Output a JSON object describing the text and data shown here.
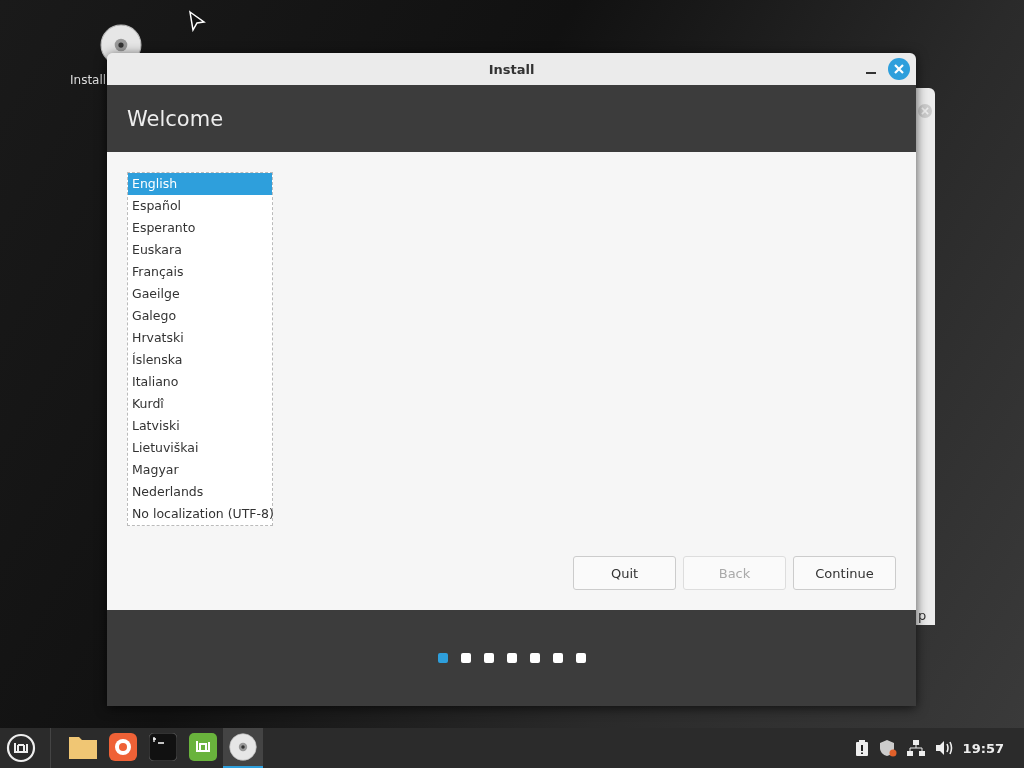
{
  "desktop_icons": [
    {
      "label": "Install"
    }
  ],
  "background_window": {
    "label": "p"
  },
  "window": {
    "title": "Install",
    "header": "Welcome",
    "languages": [
      {
        "label": "English",
        "selected": true
      },
      {
        "label": "Español",
        "selected": false
      },
      {
        "label": "Esperanto",
        "selected": false
      },
      {
        "label": "Euskara",
        "selected": false
      },
      {
        "label": "Français",
        "selected": false
      },
      {
        "label": "Gaeilge",
        "selected": false
      },
      {
        "label": "Galego",
        "selected": false
      },
      {
        "label": "Hrvatski",
        "selected": false
      },
      {
        "label": "Íslenska",
        "selected": false
      },
      {
        "label": "Italiano",
        "selected": false
      },
      {
        "label": "Kurdî",
        "selected": false
      },
      {
        "label": "Latviski",
        "selected": false
      },
      {
        "label": "Lietuviškai",
        "selected": false
      },
      {
        "label": "Magyar",
        "selected": false
      },
      {
        "label": "Nederlands",
        "selected": false
      },
      {
        "label": "No localization (UTF-8)",
        "selected": false
      }
    ],
    "buttons": [
      {
        "label": "Quit",
        "disabled": false
      },
      {
        "label": "Back",
        "disabled": true
      },
      {
        "label": "Continue",
        "disabled": false
      }
    ],
    "steps": [
      {
        "selected": true
      },
      {
        "selected": false
      },
      {
        "selected": false
      },
      {
        "selected": false
      },
      {
        "selected": false
      },
      {
        "selected": false
      },
      {
        "selected": false
      }
    ]
  },
  "taskbar": {
    "apps": [
      {
        "kind": "folder",
        "active": false
      },
      {
        "kind": "browser",
        "active": false
      },
      {
        "kind": "terminal",
        "active": false
      },
      {
        "kind": "mint",
        "active": false
      },
      {
        "kind": "disc",
        "active": true
      }
    ],
    "clock": "19:57"
  }
}
